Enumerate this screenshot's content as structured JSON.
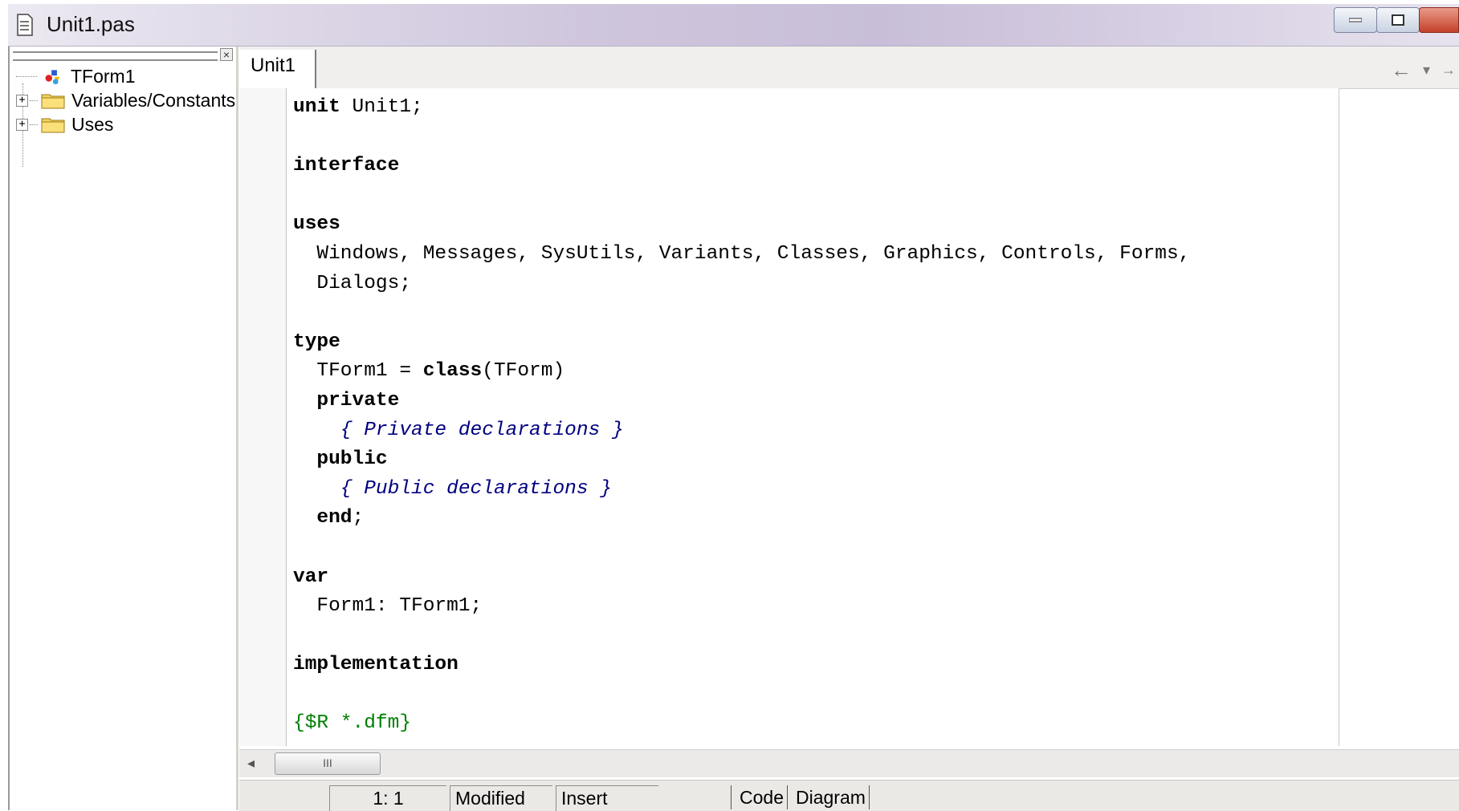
{
  "window": {
    "title": "Unit1.pas"
  },
  "tree": {
    "items": [
      {
        "label": "TForm1",
        "expandable": false,
        "icon": "form-components-icon"
      },
      {
        "label": "Variables/Constants",
        "expandable": true,
        "icon": "folder-icon"
      },
      {
        "label": "Uses",
        "expandable": true,
        "icon": "folder-icon"
      }
    ]
  },
  "editor": {
    "tab_label": "Unit1",
    "code_lines": [
      "unit Unit1;",
      "",
      "interface",
      "",
      "uses",
      "  Windows, Messages, SysUtils, Variants, Classes, Graphics, Controls, Forms,",
      "  Dialogs;",
      "",
      "type",
      "  TForm1 = class(TForm)",
      "  private",
      "    { Private declarations }",
      "  public",
      "    { Public declarations }",
      "  end;",
      "",
      "var",
      "  Form1: TForm1;",
      "",
      "implementation",
      "",
      "{$R *.dfm}"
    ]
  },
  "statusbar": {
    "position": "1:  1",
    "modified": "Modified",
    "mode": "Insert",
    "view_tabs": [
      "Code",
      "Diagram"
    ]
  },
  "scrollbar": {
    "thumb_glyph": "III"
  },
  "colors": {
    "keyword": "#000000",
    "comment": "#000080",
    "directive": "#008000"
  }
}
